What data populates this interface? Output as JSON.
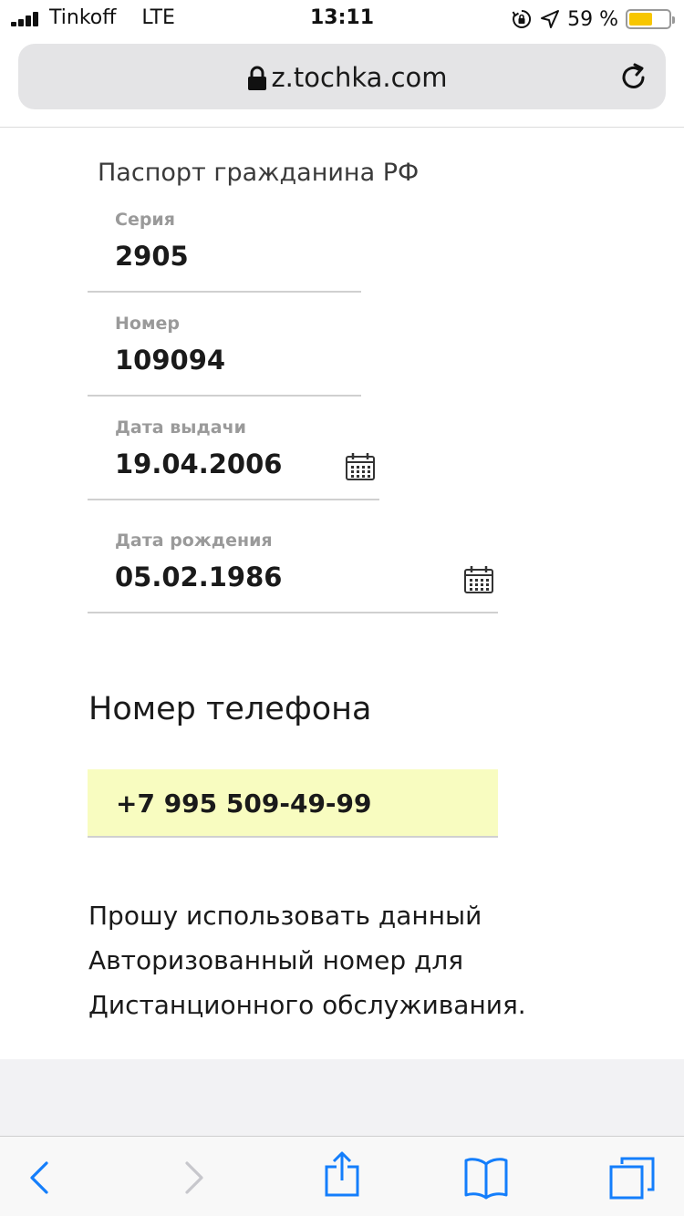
{
  "status_bar": {
    "carrier": "Tinkoff",
    "network": "LTE",
    "time": "13:11",
    "battery_percent": "59 %",
    "battery_level": 0.59,
    "battery_color": "#f7c600"
  },
  "browser": {
    "url": "z.tochka.com"
  },
  "passport": {
    "title": "Паспорт гражданина РФ",
    "series_label": "Серия",
    "series_value": "2905",
    "number_label": "Номер",
    "number_value": "109094",
    "issue_date_label": "Дата выдачи",
    "issue_date_value": "19.04.2006",
    "birth_date_label": "Дата рождения",
    "birth_date_value": "05.02.1986"
  },
  "phone": {
    "title": "Номер телефона",
    "value": "+7 995 509-49-99",
    "highlight_color": "#f8fcc0"
  },
  "consent": {
    "line1": "Прошу использовать данный",
    "line2": "Авторизованный номер для",
    "line3": "Дистанционного обслуживания."
  },
  "icons": {
    "status_bar": [
      "signal-icon",
      "orientation-lock-icon",
      "location-icon",
      "battery-icon"
    ],
    "browser": [
      "lock-icon",
      "reload-icon"
    ],
    "form": [
      "calendar-icon"
    ],
    "toolbar": [
      "back-icon",
      "forward-icon",
      "share-icon",
      "bookmarks-icon",
      "tabs-icon"
    ]
  },
  "colors": {
    "ios_blue": "#147efb",
    "disabled": "#c7c7cc"
  }
}
